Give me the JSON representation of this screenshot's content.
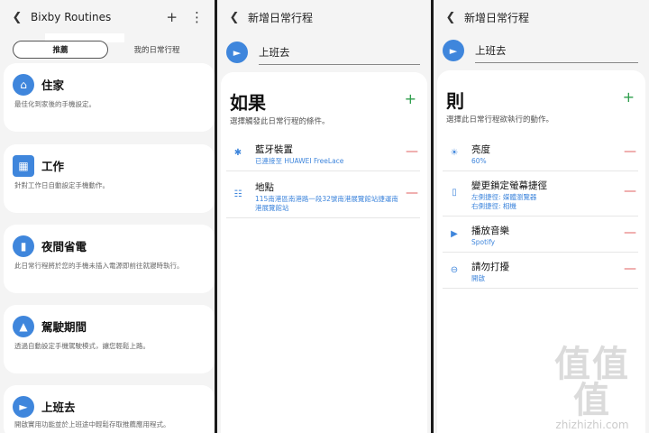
{
  "panel1": {
    "title": "Bixby Routines",
    "tabs": [
      "推薦",
      "我的日常行程"
    ],
    "cards": [
      {
        "title": "住家",
        "desc": "最佳化到家後的手機設定。"
      },
      {
        "title": "工作",
        "desc": "針對工作日自動設定手機動作。"
      },
      {
        "title": "夜間省電",
        "desc": "此日常行程將於您的手機未插入電源即前往就寢時執行。"
      },
      {
        "title": "駕駛期間",
        "desc": "透過自動設定手機駕駛模式，讓您輕鬆上路。"
      },
      {
        "title": "上班去",
        "desc": "開啟實用功能並於上班途中輕鬆存取推薦應用程式。"
      }
    ]
  },
  "panel2": {
    "title": "新增日常行程",
    "routine_name": "上班去",
    "heading": "如果",
    "subheading": "選擇觸發此日常行程的條件。",
    "conditions": [
      {
        "title": "藍牙裝置",
        "sub": "已連接至 HUAWEI FreeLace"
      },
      {
        "title": "地點",
        "sub1": "115南港區南港路一段32號南港展覽館站捷運南",
        "sub2": "港展覽館站"
      }
    ]
  },
  "panel3": {
    "title": "新增日常行程",
    "routine_name": "上班去",
    "heading": "則",
    "subheading": "選擇此日常行程欲執行的動作。",
    "actions": [
      {
        "title": "亮度",
        "sub": "60%"
      },
      {
        "title": "變更鎖定螢幕捷徑",
        "sub1": "左側捷徑: 媒體瀏覽器",
        "sub2": "右側捷徑: 相機"
      },
      {
        "title": "播放音樂",
        "sub": "Spotify"
      },
      {
        "title": "請勿打擾",
        "sub": "開啟"
      }
    ]
  },
  "watermark": {
    "big": "值值值",
    "small": "zhizhizhi.com"
  },
  "icons": {
    "back": "back-arrow-icon",
    "add": "plus-icon",
    "more": "more-vertical-icon",
    "remove": "minus-icon"
  },
  "colors": {
    "accent": "#3f86dc",
    "add": "#2e9e4c",
    "remove": "#e06060"
  }
}
